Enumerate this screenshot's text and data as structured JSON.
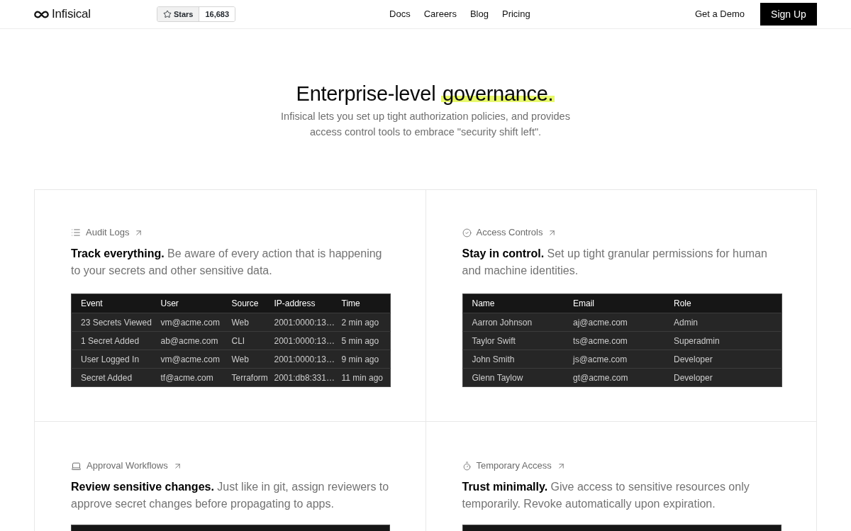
{
  "nav": {
    "logo": "Infisical",
    "stars_button": "Stars",
    "stars_count": "16,683",
    "links": [
      "Docs",
      "Careers",
      "Blog",
      "Pricing"
    ],
    "demo_link": "Get a Demo",
    "signup_button": "Sign Up"
  },
  "hero": {
    "title": "Enterprise-level",
    "highlight": "governance.",
    "subtitle": "Infisical lets you set up tight authorization policies, and provides access control tools to embrace \"security shift left\"."
  },
  "features": [
    {
      "kind": "audit",
      "label": "Audit Logs",
      "description": "**Track everything.** Be aware of every action that is happening to your secrets and other sensitive data.",
      "table": {
        "columns": [
          "Event",
          "User",
          "Source",
          "IP-address",
          "Time"
        ],
        "rows": [
          [
            "23 Secrets Viewed",
            "vm@acme.com",
            "Web",
            "2001:0000:13…",
            "2 min ago"
          ],
          [
            "1 Secret Added",
            "ab@acme.com",
            "CLI",
            "2001:0000:13…",
            "5 min ago"
          ],
          [
            "User Logged In",
            "vm@acme.com",
            "Web",
            "2001:0000:13…",
            "9 min ago"
          ],
          [
            "Secret Added",
            "tf@acme.com",
            "Terraform",
            "2001:db8:331…",
            "11 min ago"
          ]
        ]
      }
    },
    {
      "kind": "access",
      "label": "Access Controls",
      "description": "**Stay in control.** Set up tight granular permissions for human and machine identities.",
      "table": {
        "columns": [
          "Name",
          "Email",
          "Role"
        ],
        "rows": [
          [
            "Aarron Johnson",
            "aj@acme.com",
            "Admin"
          ],
          [
            "Taylor Swift",
            "ts@acme.com",
            "Superadmin"
          ],
          [
            "John Smith",
            "js@acme.com",
            "Developer"
          ],
          [
            "Glenn Taylow",
            "gt@acme.com",
            "Developer"
          ]
        ]
      }
    },
    {
      "kind": "approval",
      "label": "Approval Workflows",
      "description": "**Review sensitive changes.** Just like in git, assign reviewers to approve secret changes before propagating to apps."
    },
    {
      "kind": "temporary",
      "label": "Temporary Access",
      "description": "**Trust minimally.** Give access to sensitive resources only temporarily. Revoke automatically upon expiration."
    }
  ]
}
